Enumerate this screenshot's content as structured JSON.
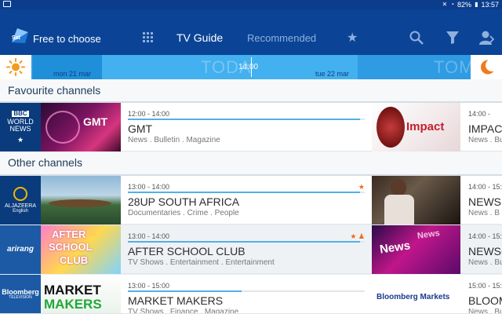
{
  "status": {
    "battery": "82%",
    "clock": "13:57"
  },
  "app": {
    "brand": "Free to choose"
  },
  "tabs": {
    "guide": "TV Guide",
    "recommended": "Recommended"
  },
  "timeline": {
    "today_big": "TODA",
    "tomorrow_big": "TOM",
    "left_date": "mon 21 mar",
    "right_date": "tue 22 mar",
    "time": "14:00"
  },
  "sections": {
    "favourites": "Favourite channels",
    "others": "Other channels"
  },
  "rows": [
    {
      "channel": [
        "BBC",
        "WORLD",
        "NEWS"
      ],
      "p1": {
        "time": "12:00 - 14:00",
        "title": "GMT",
        "genre": "News . Bulletin . Magazine",
        "progress": 0.98
      },
      "p2": {
        "time": "14:00 -",
        "title": "IMPACT",
        "genre": "News . Bu"
      },
      "thumb1": "GMT",
      "thumb2": "Impact"
    },
    {
      "channel": [
        "ALJAZEERA",
        "English"
      ],
      "p1": {
        "time": "13:00 - 14:00",
        "title": "28UP SOUTH AFRICA",
        "genre": "Documentaries . Crime . People",
        "progress": 0.98
      },
      "p2": {
        "time": "14:00 - 15:",
        "title": "NEWS H",
        "genre": "News . B"
      }
    },
    {
      "channel": [
        "arirang"
      ],
      "p1": {
        "time": "13:00 - 14:00",
        "title": "AFTER SCHOOL CLUB",
        "genre": "TV Shows . Entertainment . Entertainment",
        "progress": 0.98
      },
      "p2": {
        "time": "14:00 - 15:",
        "title": "NEWSC",
        "genre": "News . Bu"
      },
      "thumb1": [
        "AFTER",
        "SCHOOL",
        "CLUB"
      ],
      "thumb2": "News"
    },
    {
      "channel": [
        "Bloomberg",
        "TELEVISION"
      ],
      "p1": {
        "time": "13:00 - 15:00",
        "title": "MARKET MAKERS",
        "genre": "TV Shows . Finance . Magazine",
        "progress": 0.48
      },
      "p2": {
        "time": "15:00 - 15:",
        "title": "BLOOM",
        "genre": "News . Bu"
      },
      "thumb1": [
        "MARKET",
        "MAKERS"
      ],
      "thumb2": "Bloomberg Markets"
    }
  ]
}
